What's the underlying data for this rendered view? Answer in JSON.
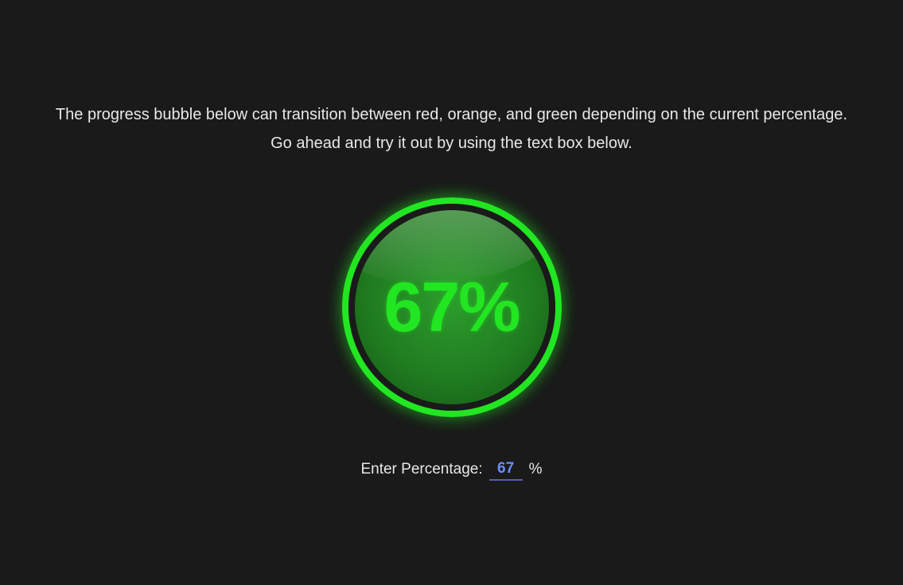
{
  "description": {
    "line1": "The progress bubble below can transition between red, orange, and green depending on the current percentage.",
    "line2": "Go ahead and try it out by using the text box below."
  },
  "progress": {
    "value": 67,
    "display": "67%",
    "color": "#22e622"
  },
  "input": {
    "label": "Enter Percentage:",
    "value": "67",
    "suffix": "%"
  }
}
